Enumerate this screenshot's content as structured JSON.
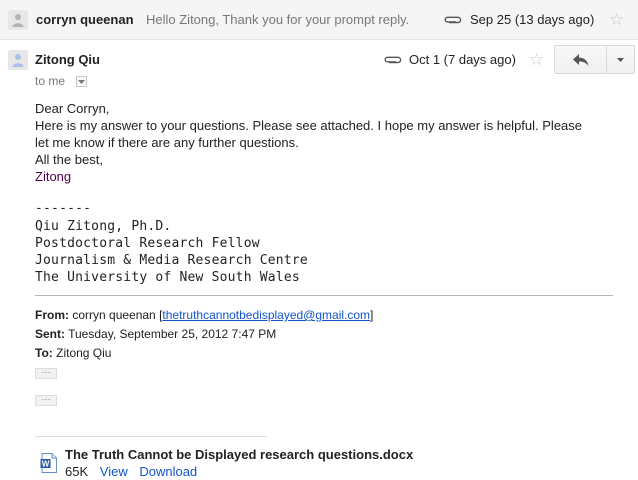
{
  "collapsed_message": {
    "sender": "corryn queenan",
    "snippet": "Hello Zitong, Thank you for your prompt reply.",
    "date": "Sep 25 (13 days ago)",
    "star_icon": "star-outline-icon",
    "attachment_icon": "paperclip-icon"
  },
  "expanded_message": {
    "sender": "Zitong Qiu",
    "recipient": "to me",
    "date": "Oct 1 (7 days ago)",
    "reply_icon": "reply-arrow-icon",
    "more_icon": "chevron-down-icon",
    "body": {
      "greeting": "Dear Corryn,",
      "line1": "Here is my answer to your questions. Please see attached. I hope my answer is helpful. Please",
      "line2": "let me know if there are any further questions.",
      "closing": "All the best,",
      "sign": "Zitong",
      "separator": "-------",
      "sig_name": "Qiu Zitong, Ph.D.",
      "sig_title": "Postdoctoral Research Fellow",
      "sig_dept": "Journalism & Media Research Centre",
      "sig_uni": "The University of New South Wales"
    },
    "quoted_header": {
      "from_label": "From:",
      "from_name": "corryn queenan [",
      "from_email": "thetruthcannotbedisplayed@gmail.com",
      "from_close": "]",
      "sent_label": "Sent:",
      "sent_value": "Tuesday, September 25, 2012 7:47 PM",
      "to_label": "To:",
      "to_value": "Zitong Qiu"
    },
    "trimmed_content_label": "···",
    "attachment": {
      "filename": "The Truth Cannot be Displayed research questions.docx",
      "size": "65K",
      "view_label": "View",
      "download_label": "Download",
      "icon": "word-document-icon"
    }
  },
  "colors": {
    "link": "#1155cc",
    "signature_purple": "#500050",
    "collapsed_bg": "#f5f5f5"
  }
}
